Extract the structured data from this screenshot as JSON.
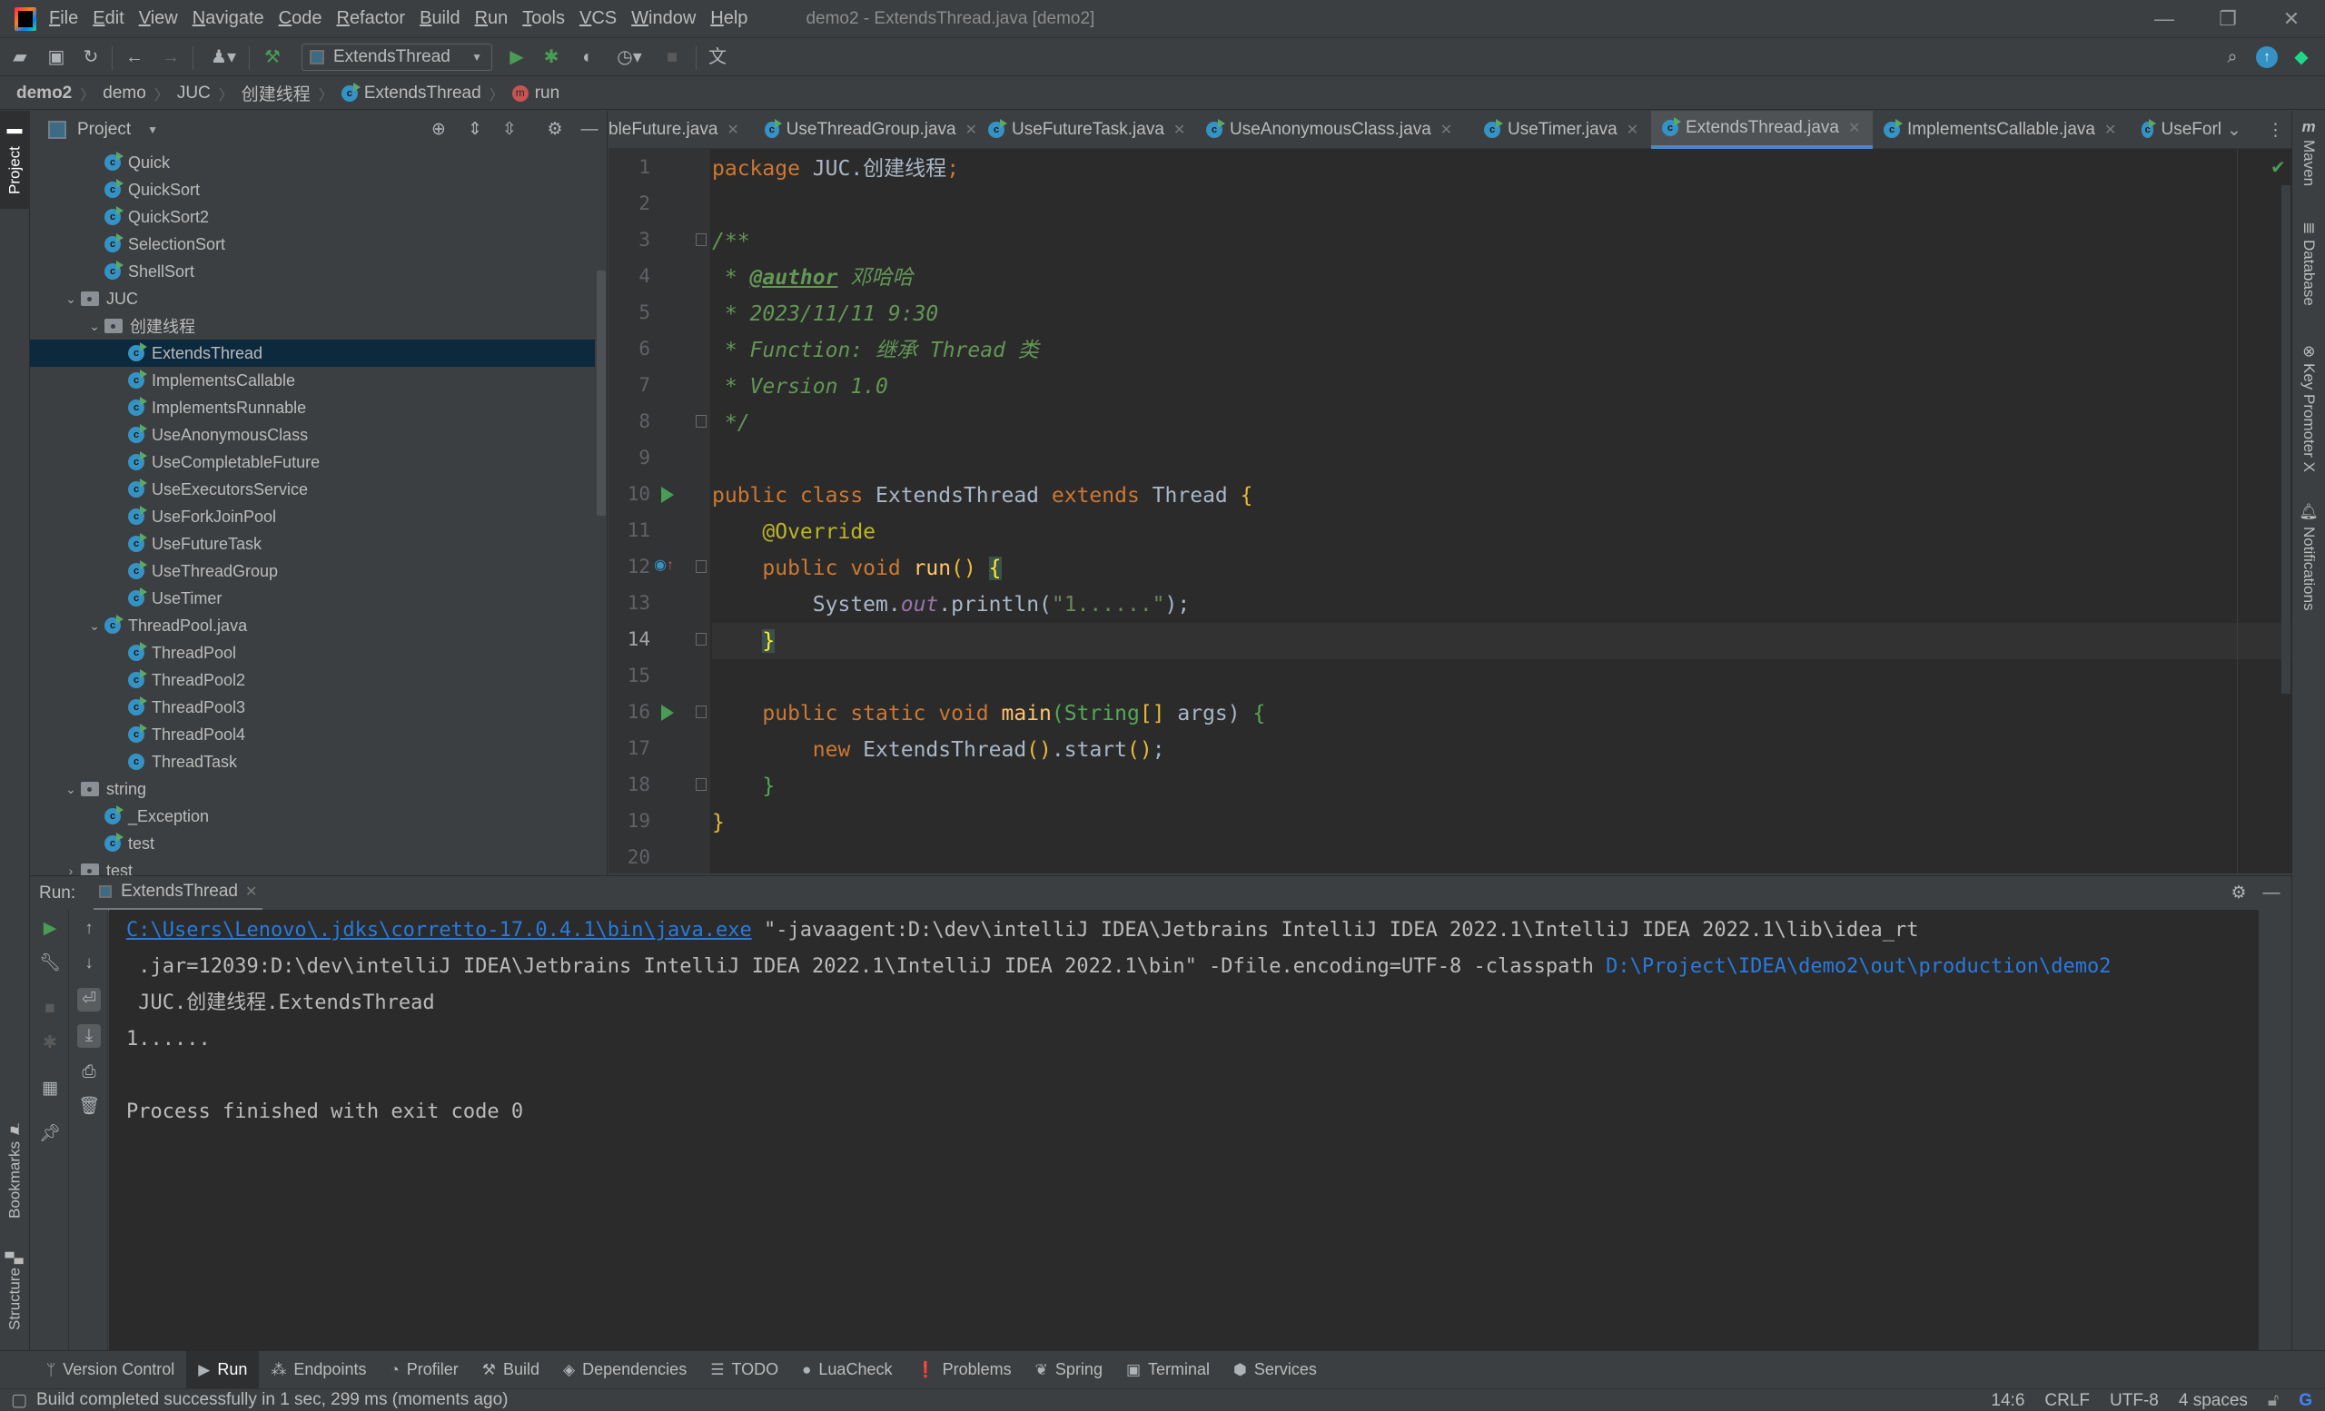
{
  "window": {
    "title": "demo2 - ExtendsThread.java [demo2]",
    "menu": [
      "File",
      "Edit",
      "View",
      "Navigate",
      "Code",
      "Refactor",
      "Build",
      "Run",
      "Tools",
      "VCS",
      "Window",
      "Help"
    ],
    "controls": {
      "minimize": "—",
      "restore": "❐",
      "close": "✕"
    }
  },
  "toolbar": {
    "run_config": "ExtendsThread",
    "icons": [
      "open-icon",
      "save-icon",
      "sync-icon",
      "back-icon",
      "forward-icon",
      "user-icon",
      "build-hammer-icon",
      "run-icon",
      "debug-icon",
      "coverage-icon",
      "profile-icon",
      "stop-icon",
      "translate-icon",
      "search-icon",
      "update-icon",
      "plugin-icon"
    ]
  },
  "breadcrumb": [
    {
      "label": "demo2",
      "bold": true
    },
    {
      "label": "demo"
    },
    {
      "label": "JUC"
    },
    {
      "label": "创建线程"
    },
    {
      "label": "ExtendsThread",
      "icon": "class"
    },
    {
      "label": "run",
      "icon": "method"
    }
  ],
  "left_stripe": {
    "project": "Project",
    "bookmarks": "Bookmarks",
    "structure": "Structure"
  },
  "project_panel": {
    "title": "Project",
    "tree": [
      {
        "label": "Quick",
        "indent": 3,
        "type": "class"
      },
      {
        "label": "QuickSort",
        "indent": 3,
        "type": "class"
      },
      {
        "label": "QuickSort2",
        "indent": 3,
        "type": "class"
      },
      {
        "label": "SelectionSort",
        "indent": 3,
        "type": "class"
      },
      {
        "label": "ShellSort",
        "indent": 3,
        "type": "class"
      },
      {
        "label": "JUC",
        "indent": 2,
        "type": "package",
        "expanded": true
      },
      {
        "label": "创建线程",
        "indent": 3,
        "type": "package",
        "expanded": true
      },
      {
        "label": "ExtendsThread",
        "indent": 4,
        "type": "class",
        "selected": true
      },
      {
        "label": "ImplementsCallable",
        "indent": 4,
        "type": "class"
      },
      {
        "label": "ImplementsRunnable",
        "indent": 4,
        "type": "class"
      },
      {
        "label": "UseAnonymousClass",
        "indent": 4,
        "type": "class"
      },
      {
        "label": "UseCompletableFuture",
        "indent": 4,
        "type": "class"
      },
      {
        "label": "UseExecutorsService",
        "indent": 4,
        "type": "class"
      },
      {
        "label": "UseForkJoinPool",
        "indent": 4,
        "type": "class"
      },
      {
        "label": "UseFutureTask",
        "indent": 4,
        "type": "class"
      },
      {
        "label": "UseThreadGroup",
        "indent": 4,
        "type": "class"
      },
      {
        "label": "UseTimer",
        "indent": 4,
        "type": "class"
      },
      {
        "label": "ThreadPool.java",
        "indent": 3,
        "type": "file",
        "expanded": true
      },
      {
        "label": "ThreadPool",
        "indent": 4,
        "type": "class"
      },
      {
        "label": "ThreadPool2",
        "indent": 4,
        "type": "class"
      },
      {
        "label": "ThreadPool3",
        "indent": 4,
        "type": "class"
      },
      {
        "label": "ThreadPool4",
        "indent": 4,
        "type": "class"
      },
      {
        "label": "ThreadTask",
        "indent": 4,
        "type": "class-plain"
      },
      {
        "label": "string",
        "indent": 2,
        "type": "package",
        "expanded": true
      },
      {
        "label": "_Exception",
        "indent": 3,
        "type": "class"
      },
      {
        "label": "test",
        "indent": 3,
        "type": "class"
      },
      {
        "label": "test",
        "indent": 2,
        "type": "package",
        "expanded": false
      }
    ]
  },
  "editor_tabs": [
    {
      "label": "bleFuture.java",
      "partial": true
    },
    {
      "label": "UseThreadGroup.java"
    },
    {
      "label": "UseFutureTask.java"
    },
    {
      "label": "UseAnonymousClass.java"
    },
    {
      "label": "UseTimer.java"
    },
    {
      "label": "ExtendsThread.java",
      "active": true
    },
    {
      "label": "ImplementsCallable.java"
    },
    {
      "label": "UseForl",
      "partial": true
    }
  ],
  "editor": {
    "current_line": 14,
    "line_numbers": [
      "1",
      "2",
      "3",
      "4",
      "5",
      "6",
      "7",
      "8",
      "9",
      "10",
      "11",
      "12",
      "13",
      "14",
      "15",
      "16",
      "17",
      "18",
      "19",
      "20"
    ],
    "code": {
      "l1_kw": "package",
      "l1_rest": " JUC.创建线程",
      "l1_semi": ";",
      "l3": "/**",
      "l4_star": " * ",
      "l4_tag": "@author",
      "l4_rest": " 邓哈哈",
      "l5": " * 2023/11/11 9:30",
      "l6": " * Function: 继承 Thread 类",
      "l7": " * Version 1.0",
      "l8": " */",
      "l10_kw1": "public class",
      "l10_name": " ExtendsThread ",
      "l10_kw2": "extends",
      "l10_sup": " Thread ",
      "l10_br": "{",
      "l11": "    @Override",
      "l12_kw": "    public void ",
      "l12_fn": "run",
      "l12_par": "() ",
      "l12_br": "{",
      "l13_a": "        System.",
      "l13_fld": "out",
      "l13_b": ".println(",
      "l13_str": "\"1......\"",
      "l13_c": ");",
      "l14_br": "}",
      "l16_kw": "    public static void ",
      "l16_fn": "main",
      "l16_a": "(String",
      "l16_b": "[]",
      "l16_c": " args) ",
      "l16_br": "{",
      "l17_kw": "        new",
      "l17_rest": " ExtendsThread",
      "l17_p": "()",
      "l17_b": ".start",
      "l17_p2": "()",
      "l17_semi": ";",
      "l18": "    }",
      "l19": "}"
    }
  },
  "right_stripe": [
    "Maven",
    "Database",
    "Key Promoter X",
    "Notifications"
  ],
  "run_panel": {
    "label": "Run:",
    "tab": "ExtendsThread",
    "console": {
      "l1_link": "C:\\Users\\Lenovo\\.jdks\\corretto-17.0.4.1\\bin\\java.exe",
      "l1_rest": " \"-javaagent:D:\\dev\\intelliJ IDEA\\Jetbrains IntelliJ IDEA 2022.1\\IntelliJ IDEA 2022.1\\lib\\idea_rt",
      "l2_rest": " .jar=12039:D:\\dev\\intelliJ IDEA\\Jetbrains IntelliJ IDEA 2022.1\\IntelliJ IDEA 2022.1\\bin\" -Dfile.encoding=UTF-8 -classpath ",
      "l2_link": "D:\\Project\\IDEA\\demo2\\out\\production\\demo2",
      "l3": " JUC.创建线程.ExtendsThread",
      "l4": "1......",
      "l6": "Process finished with exit code 0"
    }
  },
  "bottom_bar": [
    {
      "label": "Version Control",
      "icon": "ᛘ"
    },
    {
      "label": "Run",
      "icon": "▶",
      "active": true
    },
    {
      "label": "Endpoints",
      "icon": "⁂"
    },
    {
      "label": "Profiler",
      "icon": "◔"
    },
    {
      "label": "Build",
      "icon": "⚒"
    },
    {
      "label": "Dependencies",
      "icon": "◈"
    },
    {
      "label": "TODO",
      "icon": "☰"
    },
    {
      "label": "LuaCheck",
      "icon": "●"
    },
    {
      "label": "Problems",
      "icon": "❗"
    },
    {
      "label": "Spring",
      "icon": "❦"
    },
    {
      "label": "Terminal",
      "icon": "▣"
    },
    {
      "label": "Services",
      "icon": "⬢"
    }
  ],
  "status_bar": {
    "message": "Build completed successfully in 1 sec, 299 ms (moments ago)",
    "position": "14:6",
    "line_ending": "CRLF",
    "encoding": "UTF-8",
    "indent": "4 spaces"
  }
}
